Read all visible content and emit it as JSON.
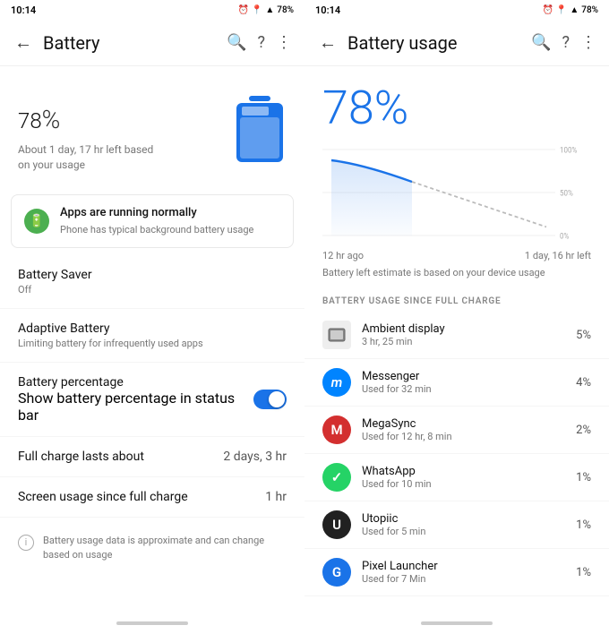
{
  "left": {
    "statusBar": {
      "time": "10:14",
      "battery": "78%"
    },
    "toolbar": {
      "title": "Battery",
      "backLabel": "←",
      "searchLabel": "🔍",
      "helpLabel": "?",
      "menuLabel": "⋮"
    },
    "hero": {
      "percentage": "78",
      "symbol": "%",
      "subtitle": "About 1 day, 17 hr left based on your usage"
    },
    "runningCard": {
      "title": "Apps are running normally",
      "subtitle": "Phone has typical background battery usage"
    },
    "items": [
      {
        "label": "Battery Saver",
        "sublabel": "Off"
      },
      {
        "label": "Adaptive Battery",
        "sublabel": "Limiting battery for infrequently used apps"
      },
      {
        "label": "Battery percentage",
        "sublabel": "Show battery percentage in status bar",
        "hasToggle": true
      },
      {
        "label": "Full charge lasts about",
        "value": "2 days, 3 hr"
      },
      {
        "label": "Screen usage since full charge",
        "value": "1 hr"
      }
    ],
    "footerNote": "Battery usage data is approximate and can change based on usage"
  },
  "right": {
    "statusBar": {
      "time": "10:14",
      "battery": "78%"
    },
    "toolbar": {
      "title": "Battery usage",
      "backLabel": "←",
      "searchLabel": "🔍",
      "helpLabel": "?",
      "menuLabel": "⋮"
    },
    "percentage": "78%",
    "chartLabels": {
      "left": "12 hr ago",
      "right": "1 day, 16 hr left"
    },
    "yLabels": [
      "100%",
      "50%",
      "0%"
    ],
    "estimateText": "Battery left estimate is based on your device usage",
    "sectionHeader": "BATTERY USAGE SINCE FULL CHARGE",
    "apps": [
      {
        "name": "Ambient display",
        "time": "3 hr, 25 min",
        "pct": "5%",
        "iconType": "ambient",
        "iconBg": "#bdbdbd"
      },
      {
        "name": "Messenger",
        "time": "Used for 32 min",
        "pct": "4%",
        "iconType": "messenger",
        "iconBg": "#0084ff"
      },
      {
        "name": "MegaSync",
        "time": "Used for 12 hr, 8 min",
        "pct": "2%",
        "iconType": "megasync",
        "iconBg": "#d32f2f"
      },
      {
        "name": "WhatsApp",
        "time": "Used for 10 min",
        "pct": "1%",
        "iconType": "whatsapp",
        "iconBg": "#25d366"
      },
      {
        "name": "Utopiic",
        "time": "Used for 5 min",
        "pct": "1%",
        "iconType": "utopiic",
        "iconBg": "#212121"
      },
      {
        "name": "Pixel Launcher",
        "time": "Used for 7 Min",
        "pct": "1%",
        "iconType": "pixellauncher",
        "iconBg": "#1a73e8"
      }
    ]
  }
}
